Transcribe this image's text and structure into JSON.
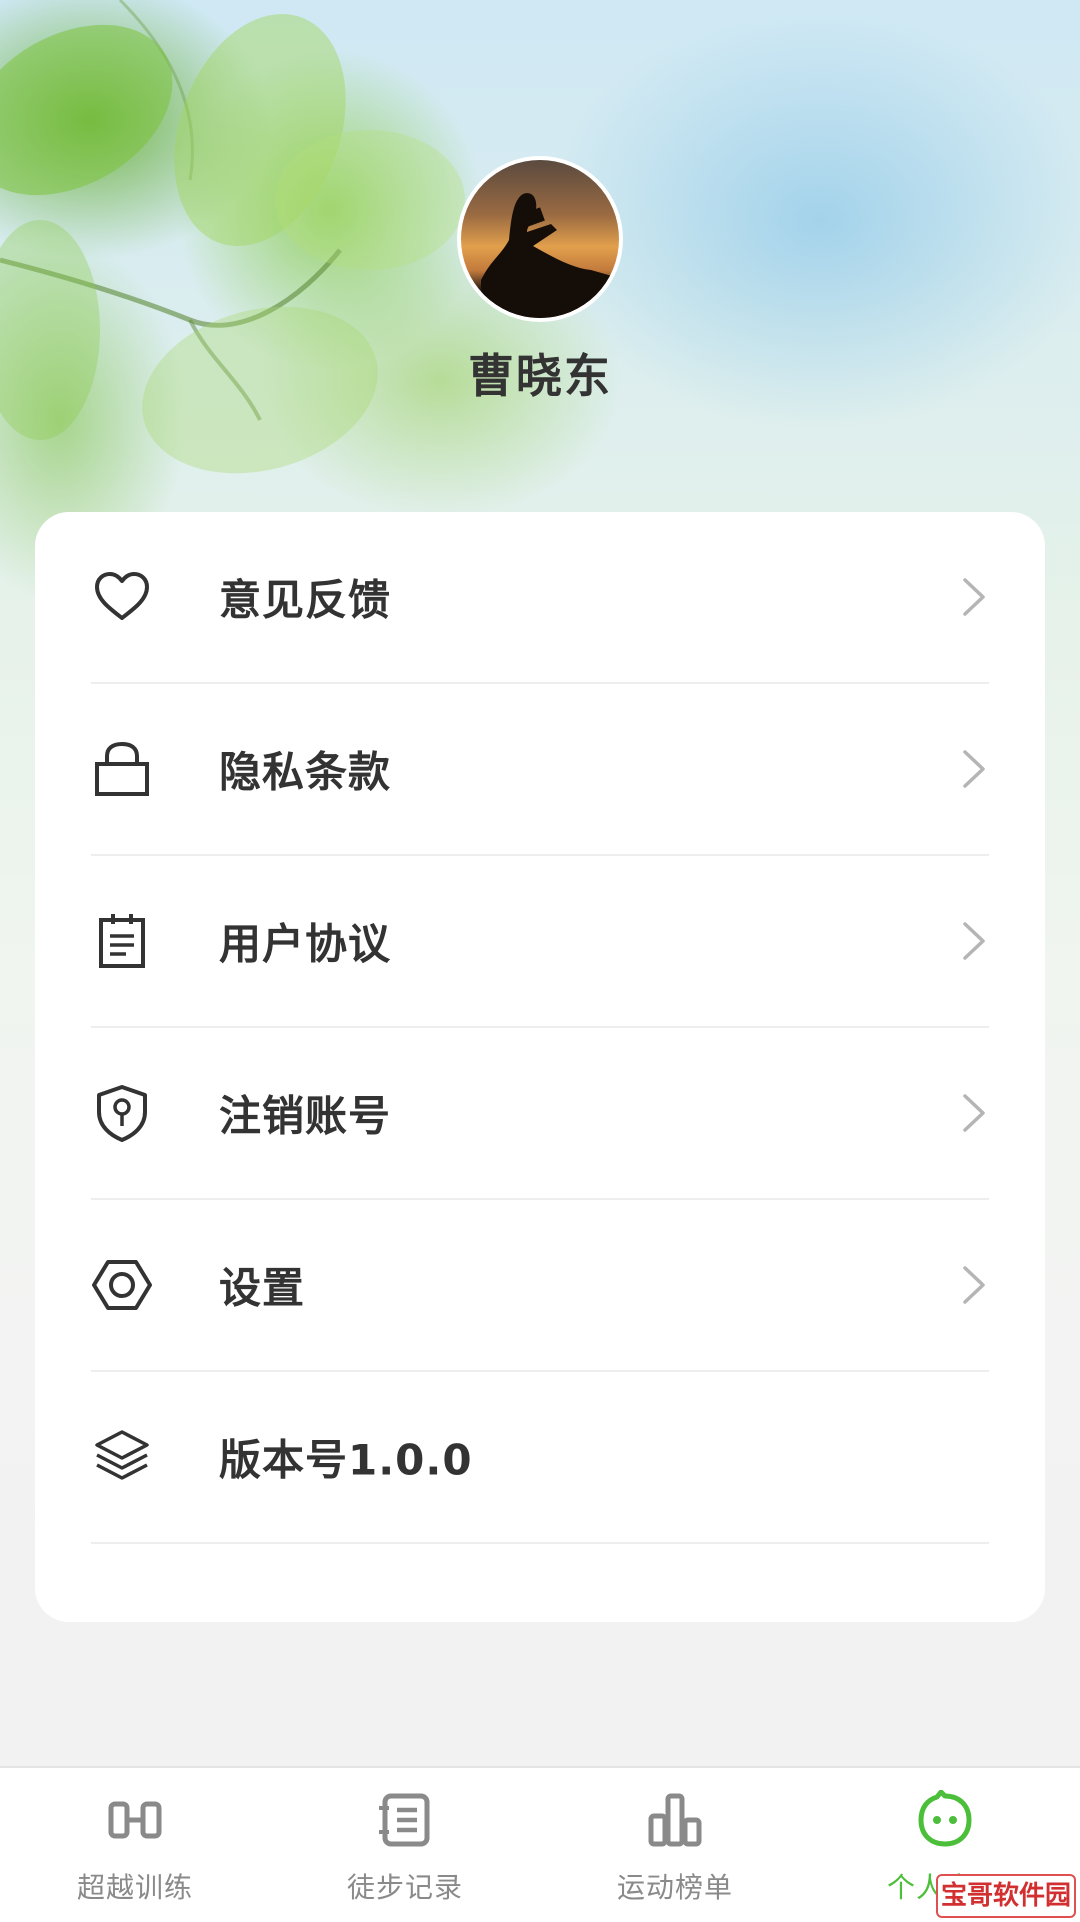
{
  "profile": {
    "username": "曹晓东"
  },
  "menu": {
    "items": [
      {
        "label": "意见反馈",
        "icon": "heart-icon"
      },
      {
        "label": "隐私条款",
        "icon": "lock-icon"
      },
      {
        "label": "用户协议",
        "icon": "document-icon"
      },
      {
        "label": "注销账号",
        "icon": "shield-key-icon"
      },
      {
        "label": "设置",
        "icon": "hexagon-settings-icon"
      },
      {
        "label": "版本号1.0.0",
        "icon": "layers-icon"
      }
    ]
  },
  "tabbar": {
    "tabs": [
      {
        "label": "超越训练",
        "icon": "training-icon"
      },
      {
        "label": "徒步记录",
        "icon": "notebook-icon"
      },
      {
        "label": "运动榜单",
        "icon": "bar-chart-icon"
      },
      {
        "label": "个人中心",
        "icon": "smiley-icon",
        "active": true
      }
    ],
    "active_color": "#4cbf3a",
    "inactive_color": "#8a8a8a"
  },
  "watermark": {
    "text": "宝哥软件园"
  }
}
